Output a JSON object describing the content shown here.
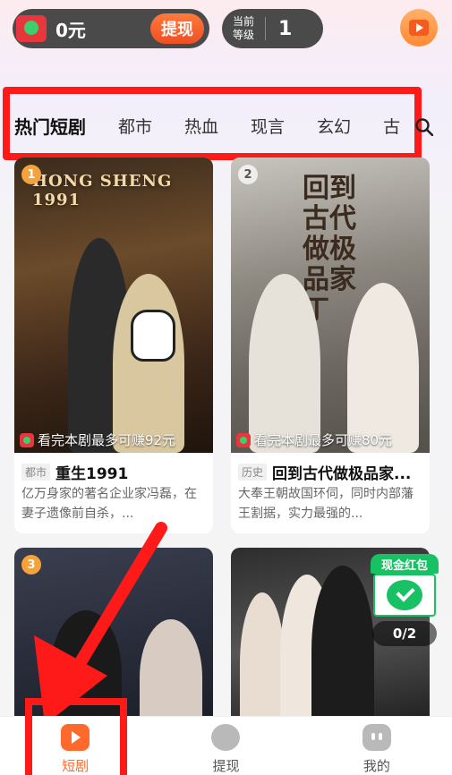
{
  "topbar": {
    "wallet_amount": "0元",
    "withdraw_label": "提现",
    "level_label": "当前等级",
    "level_value": "1"
  },
  "tabs": [
    "热门短剧",
    "都市",
    "热血",
    "现言",
    "玄幻",
    "古"
  ],
  "cards": [
    {
      "rank": "1",
      "poster_text": "HONG SHENG 1991",
      "earn": "看完本剧最多可赚92元",
      "genre": "都市",
      "title": "重生1991",
      "desc": "亿万身家的著名企业家冯磊，在妻子遗像前自杀，..."
    },
    {
      "rank": "2",
      "poster_text": "回到古代做极品家丁",
      "earn": "看完本剧最多可赚80元",
      "genre": "历史",
      "title": "回到古代做极品家...",
      "desc": "大奉王朝故国环伺，同时内部藩王割据，实力最强的..."
    },
    {
      "rank": "3"
    },
    {}
  ],
  "float_packet": {
    "label": "现金红包",
    "count": "0/2"
  },
  "bottom_nav": [
    {
      "label": "短剧",
      "active": true
    },
    {
      "label": "提现",
      "active": false
    },
    {
      "label": "我的",
      "active": false
    }
  ],
  "colors": {
    "accent": "#ff6a2c",
    "highlight_red": "#ff1a1a",
    "wechat_green": "#17c164"
  }
}
